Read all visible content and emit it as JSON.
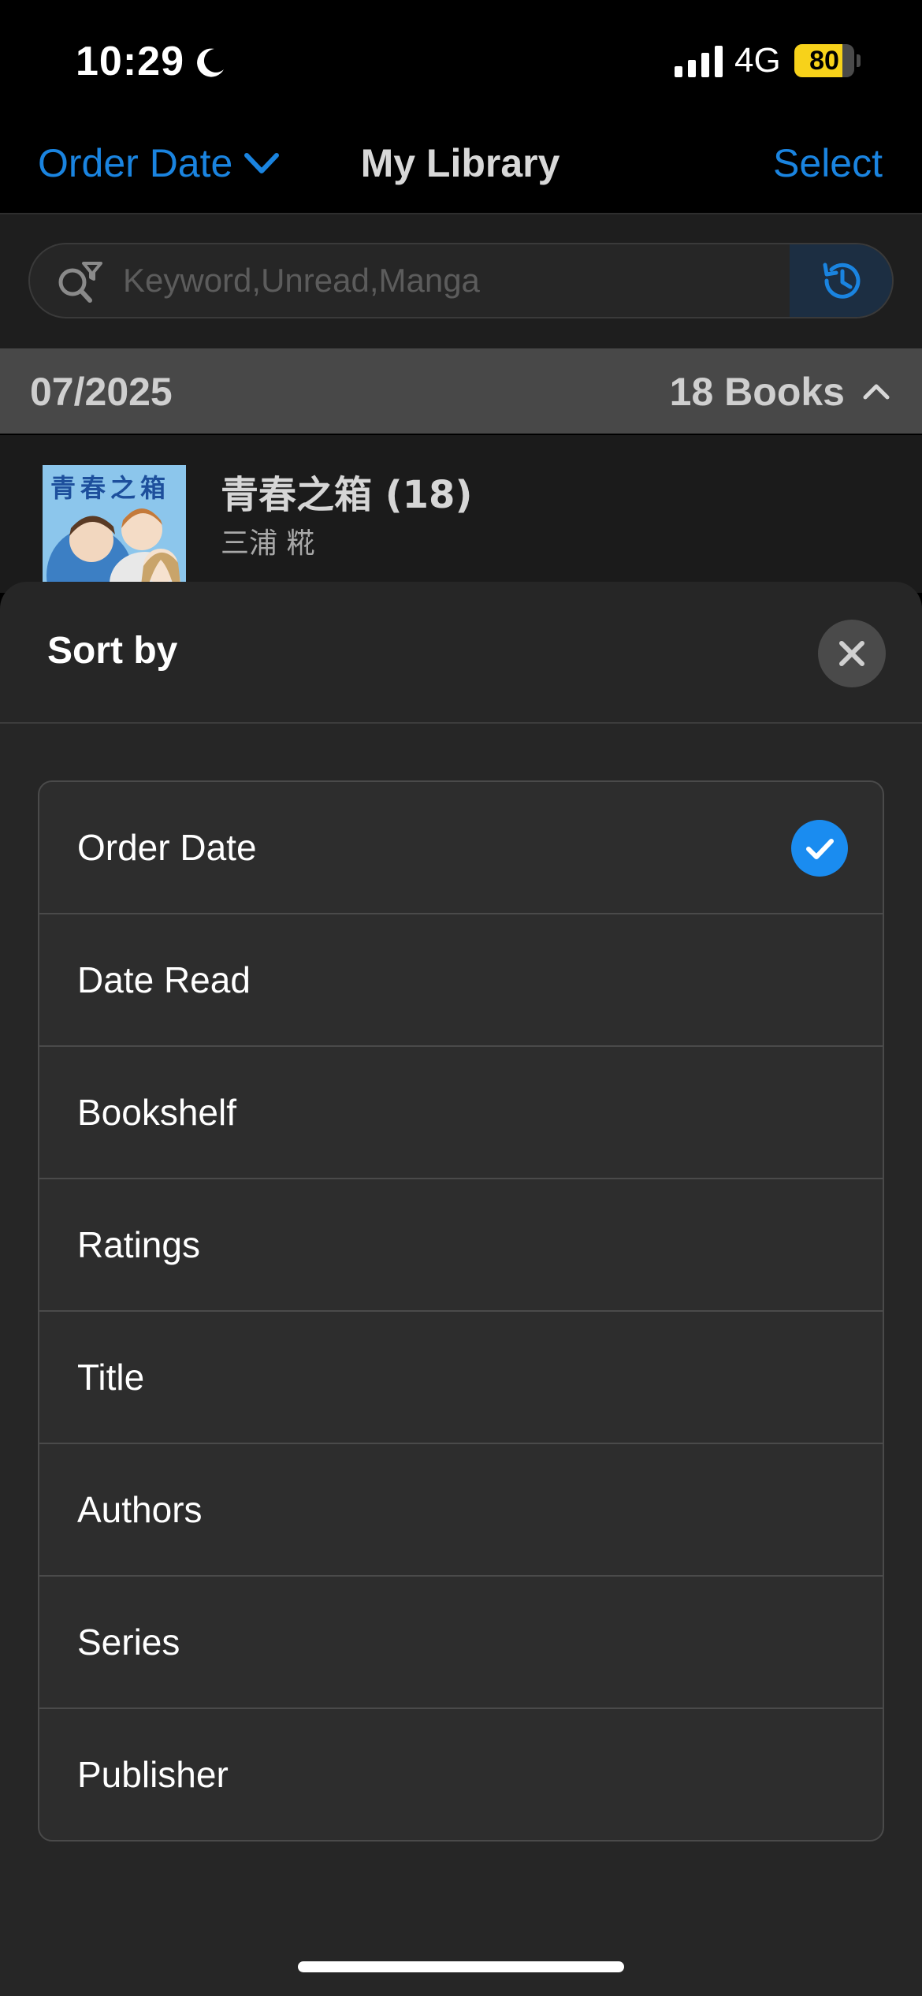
{
  "status_bar": {
    "time": "10:29",
    "network": "4G",
    "battery_percent": "80",
    "battery_level": 0.8,
    "icons": [
      "moon-icon",
      "signal-icon",
      "battery-icon"
    ]
  },
  "nav": {
    "sort_label": "Order Date",
    "title": "My Library",
    "select_label": "Select"
  },
  "search": {
    "placeholder": "Keyword,Unread,Manga",
    "value": ""
  },
  "section": {
    "date": "07/2025",
    "count": "18 Books"
  },
  "book": {
    "cover_text": "青春之箱",
    "title": "青春之箱 (18)",
    "author": "三浦 糀"
  },
  "sheet": {
    "title": "Sort by",
    "options": [
      {
        "label": "Order Date",
        "selected": true
      },
      {
        "label": "Date Read",
        "selected": false
      },
      {
        "label": "Bookshelf",
        "selected": false
      },
      {
        "label": "Ratings",
        "selected": false
      },
      {
        "label": "Title",
        "selected": false
      },
      {
        "label": "Authors",
        "selected": false
      },
      {
        "label": "Series",
        "selected": false
      },
      {
        "label": "Publisher",
        "selected": false
      }
    ]
  },
  "colors": {
    "accent": "#1a84e0",
    "check": "#1a8cf0",
    "sheet_bg": "#262626",
    "battery": "#f7d21a"
  }
}
